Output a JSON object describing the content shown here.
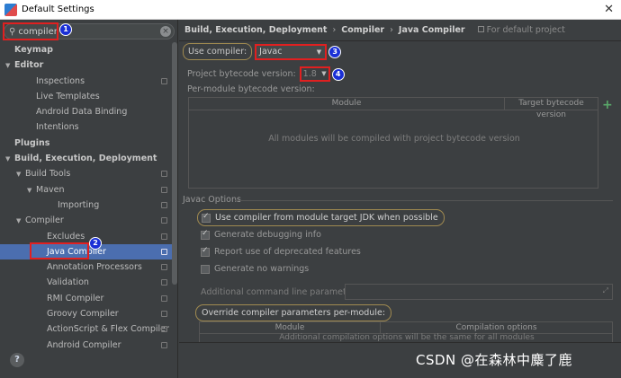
{
  "window": {
    "title": "Default Settings",
    "close_glyph": "✕"
  },
  "search": {
    "value": "compiler",
    "icon": "search-icon",
    "clear_glyph": "×"
  },
  "tree": [
    {
      "label": "Keymap",
      "level": 0,
      "bold": true,
      "arrow": "",
      "page": false
    },
    {
      "label": "Editor",
      "level": 0,
      "bold": true,
      "arrow": "▼",
      "page": false
    },
    {
      "label": "Inspections",
      "level": 2,
      "bold": false,
      "arrow": "",
      "page": true
    },
    {
      "label": "Live Templates",
      "level": 2,
      "bold": false,
      "arrow": "",
      "page": false
    },
    {
      "label": "Android Data Binding",
      "level": 2,
      "bold": false,
      "arrow": "",
      "page": false
    },
    {
      "label": "Intentions",
      "level": 2,
      "bold": false,
      "arrow": "",
      "page": false
    },
    {
      "label": "Plugins",
      "level": 0,
      "bold": true,
      "arrow": "",
      "page": false
    },
    {
      "label": "Build, Execution, Deployment",
      "level": 0,
      "bold": true,
      "arrow": "▼",
      "page": false
    },
    {
      "label": "Build Tools",
      "level": 1,
      "bold": false,
      "arrow": "▼",
      "page": true
    },
    {
      "label": "Maven",
      "level": 2,
      "bold": false,
      "arrow": "▼",
      "page": true
    },
    {
      "label": "Importing",
      "level": 4,
      "bold": false,
      "arrow": "",
      "page": true
    },
    {
      "label": "Compiler",
      "level": 1,
      "bold": false,
      "arrow": "▼",
      "page": true
    },
    {
      "label": "Excludes",
      "level": 3,
      "bold": false,
      "arrow": "",
      "page": true
    },
    {
      "label": "Java Compiler",
      "level": 3,
      "bold": false,
      "arrow": "",
      "page": true,
      "selected": true
    },
    {
      "label": "Annotation Processors",
      "level": 3,
      "bold": false,
      "arrow": "",
      "page": true
    },
    {
      "label": "Validation",
      "level": 3,
      "bold": false,
      "arrow": "",
      "page": true
    },
    {
      "label": "RMI Compiler",
      "level": 3,
      "bold": false,
      "arrow": "",
      "page": true
    },
    {
      "label": "Groovy Compiler",
      "level": 3,
      "bold": false,
      "arrow": "",
      "page": true
    },
    {
      "label": "ActionScript & Flex Compiler",
      "level": 3,
      "bold": false,
      "arrow": "",
      "page": true
    },
    {
      "label": "Android Compiler",
      "level": 3,
      "bold": false,
      "arrow": "",
      "page": true
    }
  ],
  "header": {
    "crumb1": "Build, Execution, Deployment",
    "crumb2": "Compiler",
    "crumb3": "Java Compiler",
    "separator": "›",
    "note": "For default project"
  },
  "compiler": {
    "label": "Use compiler:",
    "value": "Javac",
    "dropdown_glyph": "▼"
  },
  "bytecode": {
    "label": "Project bytecode version:",
    "value": "1.8",
    "dropdown_glyph": "▼"
  },
  "per_module": {
    "label": "Per-module bytecode version:",
    "col_module": "Module",
    "col_target": "Target bytecode version",
    "empty": "All modules will be compiled with project bytecode version",
    "add_glyph": "+"
  },
  "javac_options": {
    "title": "Javac Options",
    "options": [
      {
        "label": "Use compiler from module target JDK when possible",
        "checked": true
      },
      {
        "label": "Generate debugging info",
        "checked": true
      },
      {
        "label": "Report use of deprecated features",
        "checked": true
      },
      {
        "label": "Generate no warnings",
        "checked": false
      }
    ],
    "cmdline_label": "Additional command line parameters:",
    "expand_glyph": "⤢",
    "override_label": "Override compiler parameters per-module:",
    "override_col_module": "Module",
    "override_col_options": "Compilation options",
    "override_empty": "Additional compilation options will be the same for all modules"
  },
  "badges": [
    "1",
    "2",
    "3",
    "4"
  ],
  "help_glyph": "?",
  "watermark": "CSDN @在森林中麋了鹿",
  "colors": {
    "selection": "#4b6eaf",
    "annotation_red": "#e02020",
    "badge_blue": "#1a2fd6",
    "oval_outline": "#a08a50"
  }
}
